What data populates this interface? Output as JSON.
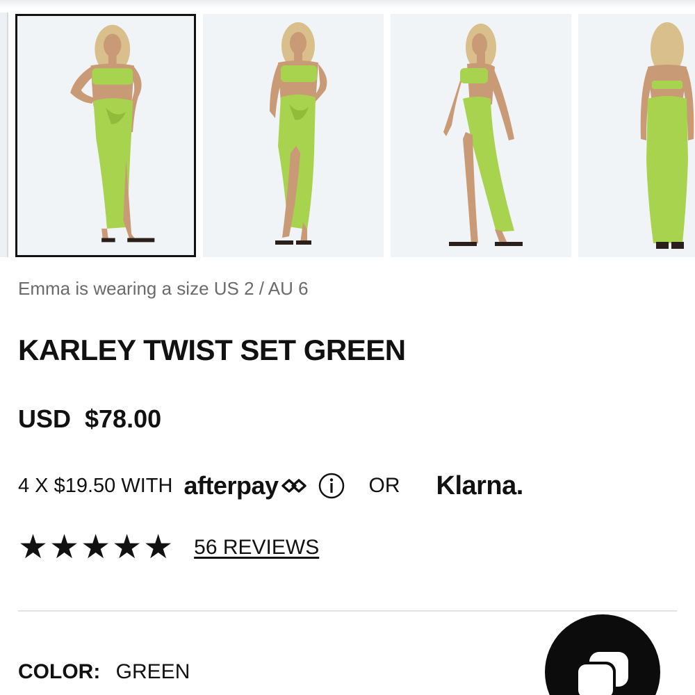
{
  "gallery": {
    "images": [
      {
        "alt": "Front view",
        "active": true
      },
      {
        "alt": "Front view 2",
        "active": false
      },
      {
        "alt": "Side view",
        "active": false
      },
      {
        "alt": "Back view",
        "active": false
      }
    ]
  },
  "product": {
    "model_caption": "Emma is wearing a size US 2 / AU 6",
    "title": "KARLEY TWIST SET GREEN",
    "price": "USD  $78.00"
  },
  "payment": {
    "installments_text": "4 X $19.50 WITH",
    "afterpay_label": "afterpay",
    "or_label": "OR",
    "klarna_label": "Klarna."
  },
  "rating": {
    "stars": 5,
    "reviews_label": "56 REVIEWS"
  },
  "options": {
    "color_label": "COLOR:",
    "color_value": "GREEN"
  },
  "colors": {
    "garment": "#a8d34f",
    "garment_shade": "#8fbc3a",
    "skin": "#c99a76",
    "hair": "#d9bf8c",
    "background": "#f1f4f7",
    "text": "#111111",
    "caption": "#6b6b6b"
  },
  "icons": {
    "afterpay": "afterpay-arrows-icon",
    "info": "info-circle-icon",
    "star": "star-icon",
    "chat": "chat-bubbles-icon"
  }
}
